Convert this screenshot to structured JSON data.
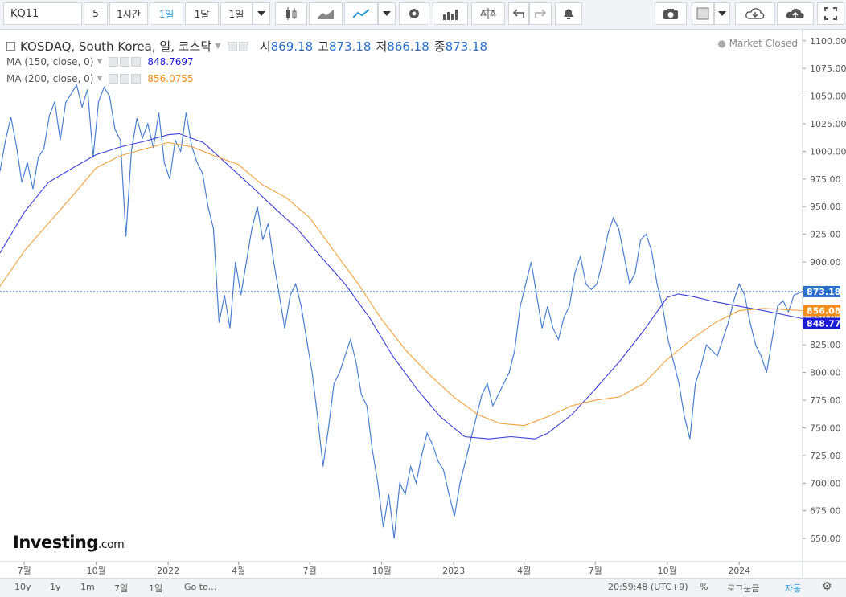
{
  "toolbar": {
    "symbol": "KQ11",
    "interval_value": "5",
    "intervals": [
      "1시간",
      "1일",
      "1달"
    ],
    "range": "1일",
    "icons": [
      "candles-icon",
      "area-chart-icon",
      "line-chart-icon",
      "dropdown-icon",
      "settings-icon",
      "indicators-icon",
      "compare-icon",
      "undo-icon",
      "redo-icon",
      "alert-icon",
      "camera-icon",
      "box-icon",
      "cloud-download-icon",
      "cloud-upload-icon",
      "fullscreen-icon"
    ]
  },
  "legend": {
    "title": "KOSDAQ, South Korea, 일, 코스닥",
    "open_label": "시",
    "open": "869.18",
    "high_label": "고",
    "high": "873.18",
    "low_label": "저",
    "low": "866.18",
    "close_label": "종",
    "close": "873.18",
    "ma150_label": "MA (150, close, 0)",
    "ma150_value": "848.7697",
    "ma200_label": "MA (200, close, 0)",
    "ma200_value": "856.0755",
    "status": "Market Closed"
  },
  "logo": {
    "brand": "Investing",
    "domain": ".com"
  },
  "bottom": {
    "ranges": [
      "10y",
      "1y",
      "1m",
      "7일",
      "1일",
      "Go to..."
    ],
    "time": "20:59:48 (UTC+9)",
    "percent": "%",
    "log": "로그눈금",
    "auto": "자동"
  },
  "colors": {
    "price": "#4a7fcf",
    "ma150": "#3b3fd6",
    "ma200": "#f2a13a",
    "last_price_bg": "#2a6fc9"
  },
  "chart_data": {
    "type": "line",
    "y_ticks": [
      650,
      675,
      700,
      725,
      750,
      775,
      800,
      825,
      850,
      875,
      900,
      925,
      950,
      975,
      1000,
      1025,
      1050,
      1075,
      1100
    ],
    "y_tick_labels": [
      "650.00",
      "675.00",
      "700.00",
      "725.00",
      "750.00",
      "775.00",
      "800.00",
      "825.00",
      "850.00",
      "875.00",
      "900.00",
      "925.00",
      "950.00",
      "975.00",
      "1000.00",
      "1025.00",
      "1050.00",
      "1075.00",
      "1100.00"
    ],
    "ylim": [
      629,
      1110
    ],
    "x_range": [
      "2021-05-31",
      "2024-03-22"
    ],
    "x_ticks": [
      {
        "date": "2021-07-01",
        "label": "7월"
      },
      {
        "date": "2021-10-01",
        "label": "10월"
      },
      {
        "date": "2022-01-01",
        "label": "2022"
      },
      {
        "date": "2022-04-01",
        "label": "4월"
      },
      {
        "date": "2022-07-01",
        "label": "7월"
      },
      {
        "date": "2022-10-01",
        "label": "10월"
      },
      {
        "date": "2023-01-01",
        "label": "2023"
      },
      {
        "date": "2023-04-01",
        "label": "4월"
      },
      {
        "date": "2023-07-01",
        "label": "7월"
      },
      {
        "date": "2023-10-01",
        "label": "10월"
      },
      {
        "date": "2024-01-01",
        "label": "2024"
      }
    ],
    "price_labels": [
      {
        "name": "last",
        "value": 873.18,
        "text": "873.18",
        "color": "#2a6fc9"
      },
      {
        "name": "ma200",
        "value": 856.08,
        "text": "856.08",
        "color": "#f28c1a"
      },
      {
        "name": "ma150",
        "value": 848.77,
        "text": "848.77",
        "color": "#1b1bd6"
      }
    ],
    "series": [
      {
        "name": "KOSDAQ",
        "color": "#4a7fcf",
        "points": [
          [
            "2021-05-31",
            982
          ],
          [
            "2021-06-07",
            1010
          ],
          [
            "2021-06-14",
            1031
          ],
          [
            "2021-06-21",
            1005
          ],
          [
            "2021-06-28",
            972
          ],
          [
            "2021-07-05",
            990
          ],
          [
            "2021-07-12",
            966
          ],
          [
            "2021-07-19",
            995
          ],
          [
            "2021-07-26",
            1002
          ],
          [
            "2021-08-02",
            1032
          ],
          [
            "2021-08-09",
            1045
          ],
          [
            "2021-08-16",
            1010
          ],
          [
            "2021-08-23",
            1044
          ],
          [
            "2021-08-30",
            1052
          ],
          [
            "2021-09-06",
            1060
          ],
          [
            "2021-09-13",
            1040
          ],
          [
            "2021-09-20",
            1056
          ],
          [
            "2021-09-27",
            995
          ],
          [
            "2021-10-04",
            1045
          ],
          [
            "2021-10-11",
            1058
          ],
          [
            "2021-10-18",
            1050
          ],
          [
            "2021-10-25",
            1020
          ],
          [
            "2021-11-01",
            1010
          ],
          [
            "2021-11-08",
            923
          ],
          [
            "2021-11-15",
            1000
          ],
          [
            "2021-11-22",
            1030
          ],
          [
            "2021-11-29",
            1012
          ],
          [
            "2021-12-06",
            1025
          ],
          [
            "2021-12-13",
            1003
          ],
          [
            "2021-12-20",
            1035
          ],
          [
            "2021-12-27",
            990
          ],
          [
            "2022-01-03",
            975
          ],
          [
            "2022-01-10",
            1010
          ],
          [
            "2022-01-17",
            1000
          ],
          [
            "2022-01-24",
            1035
          ],
          [
            "2022-01-31",
            1005
          ],
          [
            "2022-02-07",
            990
          ],
          [
            "2022-02-14",
            980
          ],
          [
            "2022-02-21",
            950
          ],
          [
            "2022-02-28",
            930
          ],
          [
            "2022-03-07",
            845
          ],
          [
            "2022-03-14",
            870
          ],
          [
            "2022-03-21",
            840
          ],
          [
            "2022-03-28",
            900
          ],
          [
            "2022-04-04",
            870
          ],
          [
            "2022-04-11",
            900
          ],
          [
            "2022-04-18",
            930
          ],
          [
            "2022-04-25",
            950
          ],
          [
            "2022-05-02",
            920
          ],
          [
            "2022-05-09",
            935
          ],
          [
            "2022-05-16",
            900
          ],
          [
            "2022-05-23",
            870
          ],
          [
            "2022-05-30",
            840
          ],
          [
            "2022-06-06",
            870
          ],
          [
            "2022-06-13",
            880
          ],
          [
            "2022-06-20",
            860
          ],
          [
            "2022-06-27",
            830
          ],
          [
            "2022-07-04",
            800
          ],
          [
            "2022-07-11",
            760
          ],
          [
            "2022-07-18",
            715
          ],
          [
            "2022-07-25",
            750
          ],
          [
            "2022-08-01",
            790
          ],
          [
            "2022-08-08",
            800
          ],
          [
            "2022-08-15",
            815
          ],
          [
            "2022-08-22",
            830
          ],
          [
            "2022-08-29",
            810
          ],
          [
            "2022-09-05",
            780
          ],
          [
            "2022-09-12",
            770
          ],
          [
            "2022-09-19",
            730
          ],
          [
            "2022-09-26",
            700
          ],
          [
            "2022-10-03",
            660
          ],
          [
            "2022-10-10",
            690
          ],
          [
            "2022-10-17",
            650
          ],
          [
            "2022-10-24",
            700
          ],
          [
            "2022-10-31",
            690
          ],
          [
            "2022-11-07",
            715
          ],
          [
            "2022-11-14",
            700
          ],
          [
            "2022-11-21",
            725
          ],
          [
            "2022-11-28",
            745
          ],
          [
            "2022-12-05",
            735
          ],
          [
            "2022-12-12",
            720
          ],
          [
            "2022-12-19",
            712
          ],
          [
            "2022-12-26",
            690
          ],
          [
            "2023-01-02",
            670
          ],
          [
            "2023-01-09",
            700
          ],
          [
            "2023-01-16",
            720
          ],
          [
            "2023-01-23",
            740
          ],
          [
            "2023-01-30",
            760
          ],
          [
            "2023-02-06",
            780
          ],
          [
            "2023-02-13",
            790
          ],
          [
            "2023-02-20",
            770
          ],
          [
            "2023-02-27",
            780
          ],
          [
            "2023-03-06",
            790
          ],
          [
            "2023-03-13",
            800
          ],
          [
            "2023-03-20",
            820
          ],
          [
            "2023-03-27",
            860
          ],
          [
            "2023-04-03",
            880
          ],
          [
            "2023-04-10",
            900
          ],
          [
            "2023-04-17",
            870
          ],
          [
            "2023-04-24",
            840
          ],
          [
            "2023-05-01",
            860
          ],
          [
            "2023-05-08",
            840
          ],
          [
            "2023-05-15",
            830
          ],
          [
            "2023-05-22",
            850
          ],
          [
            "2023-05-29",
            860
          ],
          [
            "2023-06-05",
            890
          ],
          [
            "2023-06-12",
            905
          ],
          [
            "2023-06-19",
            880
          ],
          [
            "2023-06-26",
            875
          ],
          [
            "2023-07-03",
            880
          ],
          [
            "2023-07-10",
            900
          ],
          [
            "2023-07-17",
            925
          ],
          [
            "2023-07-24",
            940
          ],
          [
            "2023-07-31",
            930
          ],
          [
            "2023-08-07",
            905
          ],
          [
            "2023-08-14",
            880
          ],
          [
            "2023-08-21",
            890
          ],
          [
            "2023-08-28",
            920
          ],
          [
            "2023-09-04",
            925
          ],
          [
            "2023-09-11",
            910
          ],
          [
            "2023-09-18",
            880
          ],
          [
            "2023-09-25",
            860
          ],
          [
            "2023-10-02",
            830
          ],
          [
            "2023-10-09",
            810
          ],
          [
            "2023-10-16",
            790
          ],
          [
            "2023-10-23",
            760
          ],
          [
            "2023-10-30",
            740
          ],
          [
            "2023-11-06",
            790
          ],
          [
            "2023-11-13",
            805
          ],
          [
            "2023-11-20",
            825
          ],
          [
            "2023-11-27",
            820
          ],
          [
            "2023-12-04",
            815
          ],
          [
            "2023-12-11",
            830
          ],
          [
            "2023-12-18",
            845
          ],
          [
            "2023-12-25",
            865
          ],
          [
            "2024-01-01",
            880
          ],
          [
            "2024-01-08",
            870
          ],
          [
            "2024-01-15",
            845
          ],
          [
            "2024-01-22",
            825
          ],
          [
            "2024-01-29",
            815
          ],
          [
            "2024-02-05",
            800
          ],
          [
            "2024-02-12",
            830
          ],
          [
            "2024-02-19",
            860
          ],
          [
            "2024-02-26",
            865
          ],
          [
            "2024-03-04",
            855
          ],
          [
            "2024-03-11",
            870
          ],
          [
            "2024-03-22",
            873.18
          ]
        ]
      },
      {
        "name": "MA (150, close, 0)",
        "color": "#3b3fd6",
        "points": [
          [
            "2021-05-31",
            908
          ],
          [
            "2021-07-01",
            945
          ],
          [
            "2021-08-01",
            972
          ],
          [
            "2021-09-01",
            985
          ],
          [
            "2021-10-01",
            997
          ],
          [
            "2021-11-01",
            1004
          ],
          [
            "2021-12-01",
            1009
          ],
          [
            "2022-01-01",
            1015
          ],
          [
            "2022-01-15",
            1016
          ],
          [
            "2022-02-15",
            1008
          ],
          [
            "2022-03-15",
            990
          ],
          [
            "2022-04-15",
            970
          ],
          [
            "2022-05-15",
            950
          ],
          [
            "2022-06-15",
            930
          ],
          [
            "2022-07-15",
            905
          ],
          [
            "2022-08-15",
            880
          ],
          [
            "2022-09-15",
            850
          ],
          [
            "2022-10-15",
            815
          ],
          [
            "2022-11-15",
            785
          ],
          [
            "2022-12-15",
            760
          ],
          [
            "2023-01-15",
            742
          ],
          [
            "2023-02-15",
            740
          ],
          [
            "2023-03-15",
            742
          ],
          [
            "2023-04-15",
            740
          ],
          [
            "2023-05-01",
            745
          ],
          [
            "2023-06-01",
            762
          ],
          [
            "2023-07-01",
            785
          ],
          [
            "2023-08-01",
            810
          ],
          [
            "2023-09-01",
            838
          ],
          [
            "2023-10-01",
            868
          ],
          [
            "2023-10-15",
            871
          ],
          [
            "2023-11-01",
            869
          ],
          [
            "2023-12-01",
            864
          ],
          [
            "2024-01-01",
            860
          ],
          [
            "2024-02-01",
            856
          ],
          [
            "2024-03-22",
            848.77
          ]
        ]
      },
      {
        "name": "MA (200, close, 0)",
        "color": "#f2a13a",
        "points": [
          [
            "2021-05-31",
            878
          ],
          [
            "2021-07-01",
            910
          ],
          [
            "2021-08-01",
            935
          ],
          [
            "2021-09-01",
            960
          ],
          [
            "2021-10-01",
            985
          ],
          [
            "2021-11-01",
            996
          ],
          [
            "2021-12-01",
            1002
          ],
          [
            "2022-01-01",
            1008
          ],
          [
            "2022-02-01",
            1004
          ],
          [
            "2022-03-01",
            996
          ],
          [
            "2022-04-01",
            988
          ],
          [
            "2022-05-01",
            970
          ],
          [
            "2022-06-01",
            958
          ],
          [
            "2022-07-01",
            940
          ],
          [
            "2022-08-01",
            910
          ],
          [
            "2022-09-01",
            880
          ],
          [
            "2022-10-01",
            848
          ],
          [
            "2022-11-01",
            820
          ],
          [
            "2022-12-01",
            798
          ],
          [
            "2023-01-01",
            778
          ],
          [
            "2023-02-01",
            762
          ],
          [
            "2023-03-01",
            754
          ],
          [
            "2023-04-01",
            752
          ],
          [
            "2023-05-01",
            760
          ],
          [
            "2023-06-01",
            770
          ],
          [
            "2023-07-01",
            775
          ],
          [
            "2023-08-01",
            778
          ],
          [
            "2023-09-01",
            790
          ],
          [
            "2023-10-01",
            812
          ],
          [
            "2023-11-01",
            830
          ],
          [
            "2023-12-01",
            845
          ],
          [
            "2024-01-01",
            856
          ],
          [
            "2024-02-01",
            858
          ],
          [
            "2024-03-22",
            856.08
          ]
        ]
      }
    ]
  }
}
